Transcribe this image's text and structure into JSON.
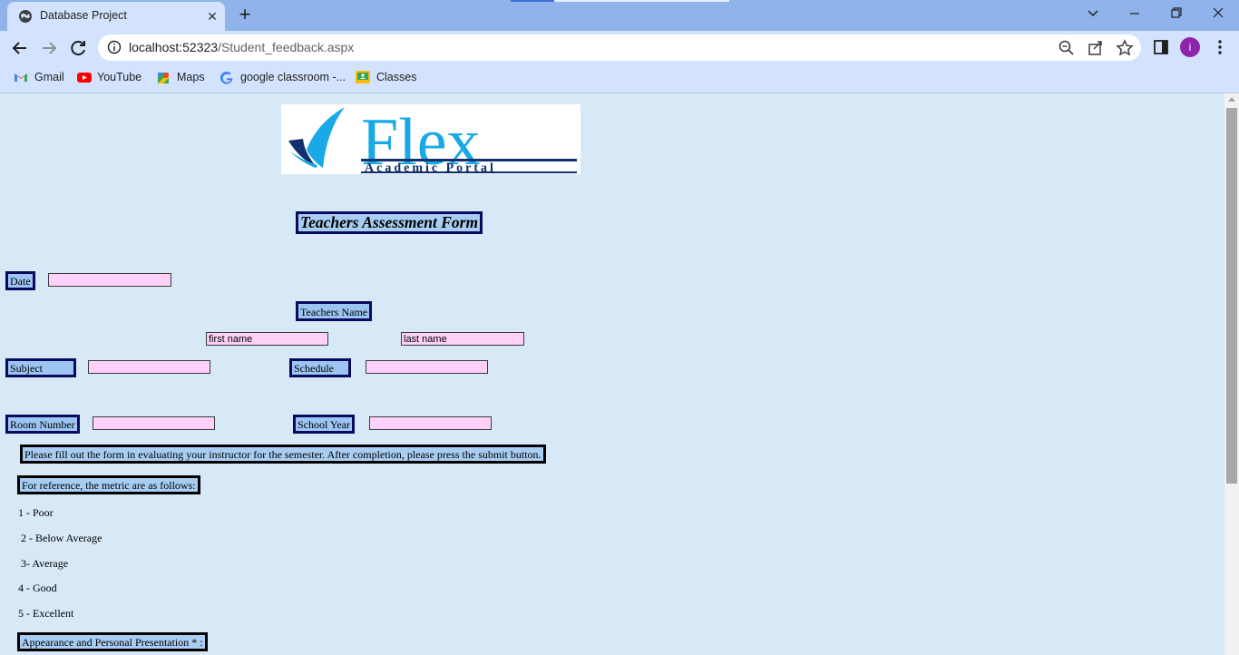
{
  "browser": {
    "tab_title": "Database Project",
    "url_host": "localhost:52323",
    "url_path": "/Student_feedback.aspx",
    "avatar_letter": "i",
    "bookmarks": [
      {
        "label": "Gmail"
      },
      {
        "label": "YouTube"
      },
      {
        "label": "Maps"
      },
      {
        "label": "google classroom -..."
      },
      {
        "label": "Classes"
      }
    ]
  },
  "page": {
    "logo_text": "Flex",
    "logo_subtext": "Academic Portal",
    "form_title": "Teachers Assessment Form",
    "date_label": "Date",
    "teachers_name_label": "Teachers Name",
    "first_name_placeholder": "first name",
    "last_name_placeholder": "last name",
    "subject_label": "Subject",
    "schedule_label": "Schedule",
    "room_number_label": "Room Number",
    "school_year_label": "School Year",
    "instructions": "Please fill out the form in evaluating your instructor for the semester. After completion, please press the submit button.",
    "reference_label": "For reference, the metric are as follows:",
    "metrics": [
      "1 - Poor",
      "2 - Below Average",
      "3- Average",
      "4 - Good",
      "5 - Excellent"
    ],
    "section_label": "Appearance and Personal Presentation * :"
  },
  "colors": {
    "chrome_tabstrip": "#8fb3ea",
    "chrome_toolbar": "#d3e3fd",
    "page_bg": "#d7e8f7",
    "label_bg": "#9cc5f3",
    "label_border": "#0a0a5c",
    "input_bg": "#ffd1f8",
    "logo_blue": "#18a9e6",
    "logo_navy": "#12306b"
  }
}
